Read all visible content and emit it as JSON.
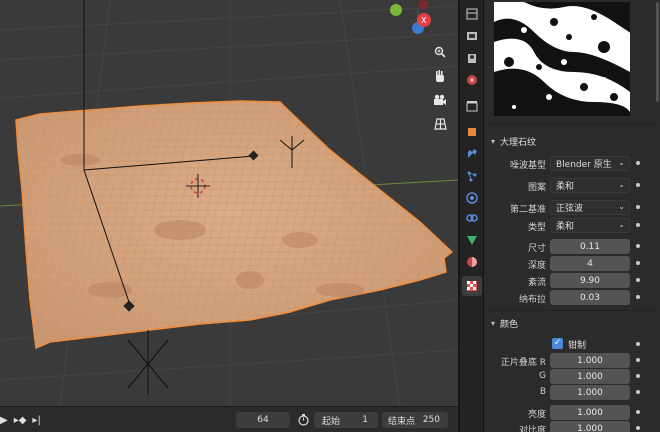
{
  "viewport": {
    "nav_icons": [
      "zoom-icon",
      "hand-pan-icon",
      "camera-icon",
      "grid-icon"
    ],
    "gizmo": {
      "y_axis_color": "#7ab838",
      "x_axis_color": "#e0404a",
      "z_axis_color": "#3a7ad4",
      "x_label": "X"
    },
    "plane_color": "#d3a27c",
    "selection_outline_color": "#f08c3a"
  },
  "timeline": {
    "current_frame": "64",
    "start_label": "起始",
    "start_value": "1",
    "end_label": "结束点",
    "end_value": "250"
  },
  "tabs": [
    "tool-icon",
    "render-icon",
    "output-icon",
    "view-layer-icon",
    "scene-icon",
    "world-icon",
    "object-icon",
    "modifier-icon",
    "particles-icon",
    "physics-icon",
    "constraints-icon",
    "data-icon",
    "material-icon",
    "texture-icon"
  ],
  "texture_panel": {
    "header": "大理石纹",
    "fields": [
      {
        "label": "噪波基型",
        "type": "dropdown",
        "value": "Blender 原生"
      },
      {
        "label": "图案",
        "type": "dropdown",
        "value": "柔和"
      },
      {
        "label": "第二基准",
        "type": "dropdown",
        "value": "正弦波"
      },
      {
        "label": "类型",
        "type": "dropdown",
        "value": "柔和"
      },
      {
        "label": "尺寸",
        "type": "number",
        "value": "0.11"
      },
      {
        "label": "深度",
        "type": "number",
        "value": "4"
      },
      {
        "label": "紊流",
        "type": "number",
        "value": "9.90"
      },
      {
        "label": "纳布拉",
        "type": "number",
        "value": "0.03"
      }
    ]
  },
  "color_panel": {
    "header": "颜色",
    "clamp_label": "钳制",
    "clamp_checked": true,
    "fields": [
      {
        "label": "正片叠底 R",
        "value": "1.000"
      },
      {
        "label": "G",
        "value": "1.000"
      },
      {
        "label": "B",
        "value": "1.000"
      },
      {
        "label": "亮度",
        "value": "1.000"
      },
      {
        "label": "对比度",
        "value": "1.000"
      }
    ]
  }
}
